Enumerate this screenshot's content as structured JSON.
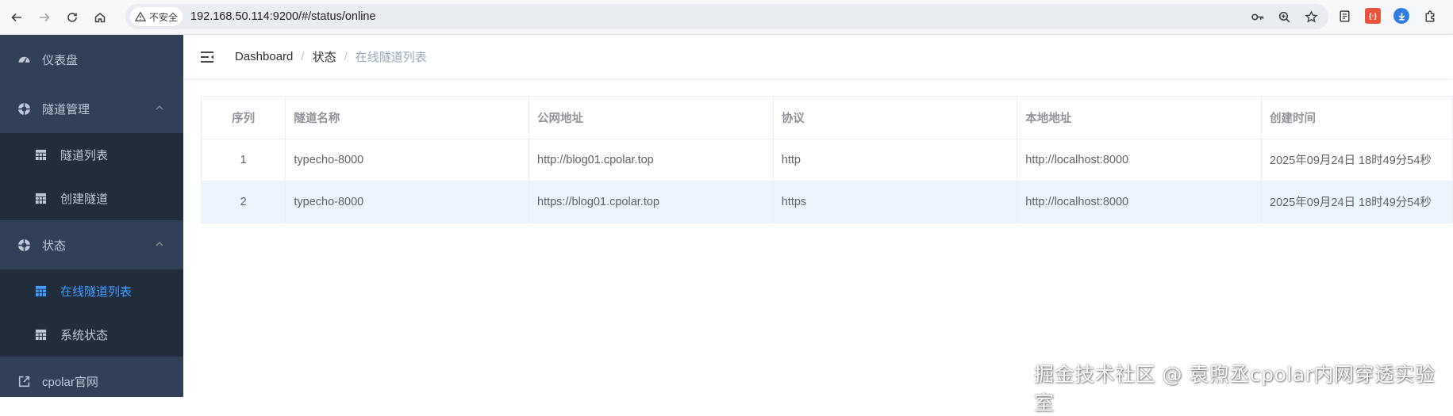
{
  "browser": {
    "security_label": "不安全",
    "url": "192.168.50.114:9200/#/status/online"
  },
  "sidebar": {
    "items": [
      {
        "label": "仪表盘",
        "icon": "dashboard-icon"
      },
      {
        "label": "隧道管理",
        "icon": "lifebuoy-icon",
        "expanded": true,
        "children": [
          {
            "label": "隧道列表",
            "icon": "table-icon"
          },
          {
            "label": "创建隧道",
            "icon": "table-icon"
          }
        ]
      },
      {
        "label": "状态",
        "icon": "lifebuoy-icon",
        "expanded": true,
        "children": [
          {
            "label": "在线隧道列表",
            "icon": "table-icon",
            "active": true
          },
          {
            "label": "系统状态",
            "icon": "table-icon"
          }
        ]
      },
      {
        "label": "cpolar官网",
        "icon": "external-link-icon"
      }
    ]
  },
  "breadcrumb": [
    "Dashboard",
    "状态",
    "在线隧道列表"
  ],
  "table": {
    "columns": [
      "序列",
      "隧道名称",
      "公网地址",
      "协议",
      "本地地址",
      "创建时间"
    ],
    "rows": [
      [
        "1",
        "typecho-8000",
        "http://blog01.cpolar.top",
        "http",
        "http://localhost:8000",
        "2025年09月24日 18时49分54秒"
      ],
      [
        "2",
        "typecho-8000",
        "https://blog01.cpolar.top",
        "https",
        "http://localhost:8000",
        "2025年09月24日 18时49分54秒"
      ]
    ]
  },
  "watermark": "掘金技术社区 @ 袁煦丞cpolar内网穿透实验室",
  "colors": {
    "sidebar_bg": "#304156",
    "submenu_bg": "#1f2d3d",
    "active": "#409eff",
    "row_highlight": "#ecf5ff"
  }
}
